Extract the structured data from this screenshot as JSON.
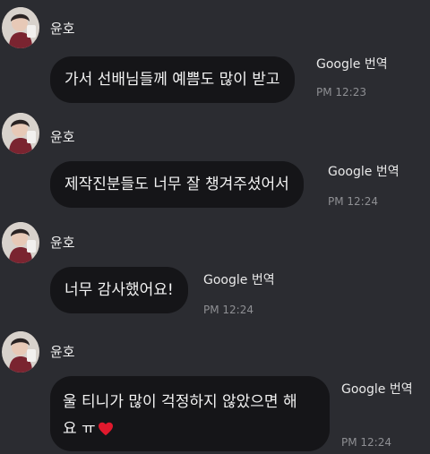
{
  "messages": [
    {
      "sender": "윤호",
      "text": "가서 선배님들께 예쁨도 많이 받고",
      "translate_label": "Google 번역",
      "time": "PM 12:23"
    },
    {
      "sender": "윤호",
      "text": "제작진분들도 너무 잘 챙겨주셨어서",
      "translate_label": "Google 번역",
      "time": "PM 12:24"
    },
    {
      "sender": "윤호",
      "text": "너무 감사했어요!",
      "translate_label": "Google 번역",
      "time": "PM 12:24"
    },
    {
      "sender": "윤호",
      "text_line1": "울 티니가 많이 걱정하지 않았으면 해",
      "text_line2": "요 ㅠ",
      "translate_label": "Google 번역",
      "time": "PM 12:24"
    }
  ],
  "colors": {
    "background": "#2b2c31",
    "bubble": "#151518",
    "heart": "#e0192d"
  },
  "icons": {
    "heart": "red-heart-emoji-icon"
  }
}
